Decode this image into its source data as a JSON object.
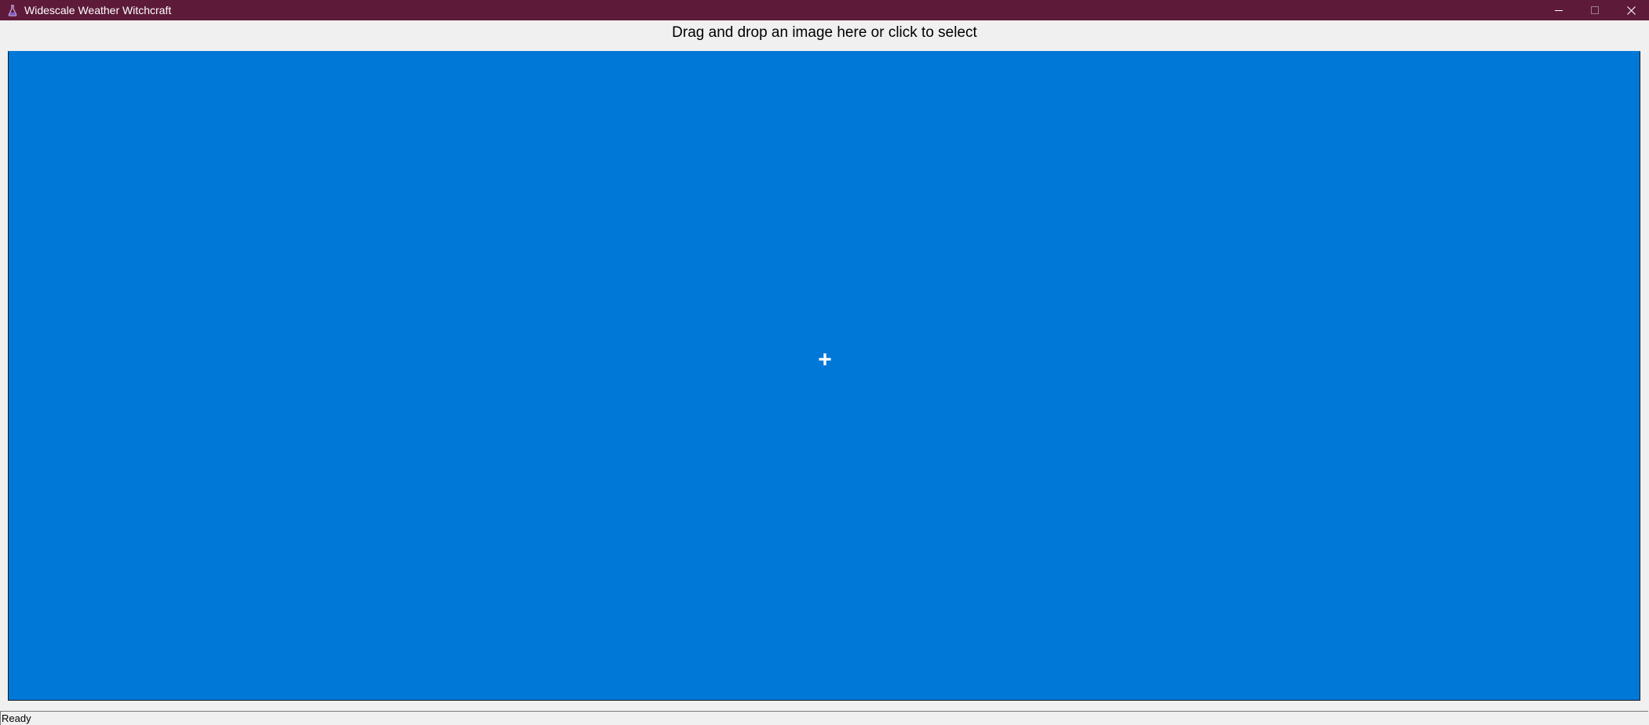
{
  "window": {
    "title": "Widescale Weather Witchcraft",
    "title_bar_color": "#5d1a39",
    "app_icon": "flask-icon",
    "caption_buttons": [
      "minimize-icon",
      "maximize-icon",
      "close-icon"
    ]
  },
  "instruction": {
    "text": "Drag and drop an image here or click to select"
  },
  "dropzone": {
    "background_color": "#0078d7",
    "icon": "plus-icon",
    "icon_glyph": "+"
  },
  "status": {
    "text": "Ready"
  }
}
